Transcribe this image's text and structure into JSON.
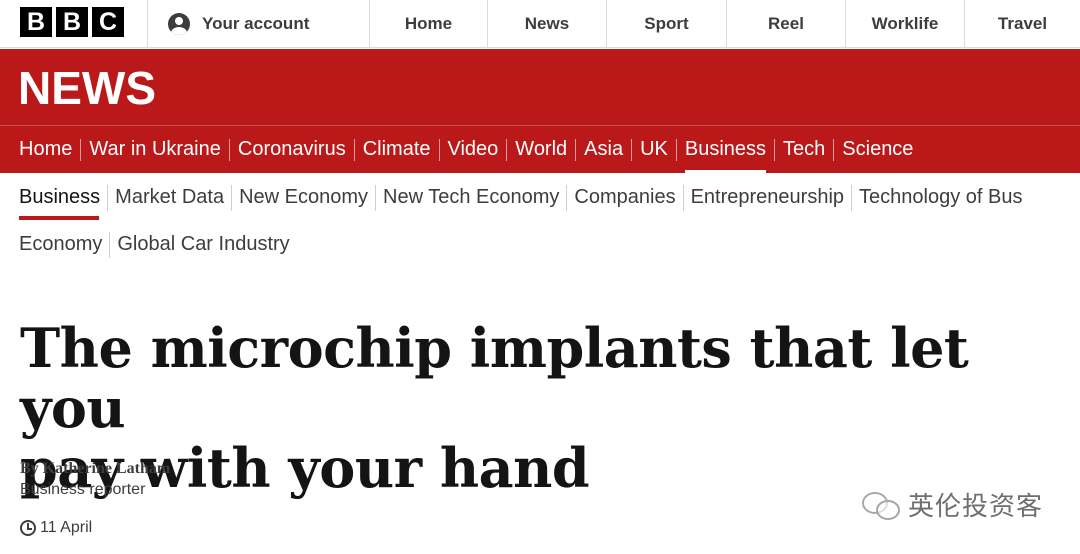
{
  "topbar": {
    "logo_letters": [
      "B",
      "B",
      "C"
    ],
    "account_label": "Your account",
    "nav": [
      "Home",
      "News",
      "Sport",
      "Reel",
      "Worklife",
      "Travel"
    ]
  },
  "banner": {
    "title": "NEWS",
    "color": "#bb1919"
  },
  "section_nav": {
    "items": [
      "Home",
      "War in Ukraine",
      "Coronavirus",
      "Climate",
      "Video",
      "World",
      "Asia",
      "UK",
      "Business",
      "Tech",
      "Science"
    ],
    "active": "Business"
  },
  "sub_nav": {
    "row1": [
      "Business",
      "Market Data",
      "New Economy",
      "New Tech Economy",
      "Companies",
      "Entrepreneurship",
      "Technology of Bus"
    ],
    "row2": [
      "Economy",
      "Global Car Industry"
    ],
    "active": "Business"
  },
  "article": {
    "headline_line1": "The microchip implants that let you",
    "headline_line2": "pay with your hand",
    "byline": "By Katherine Latham",
    "role": "Business reporter",
    "date": "11 April"
  },
  "watermark": {
    "text": "英伦投资客"
  }
}
